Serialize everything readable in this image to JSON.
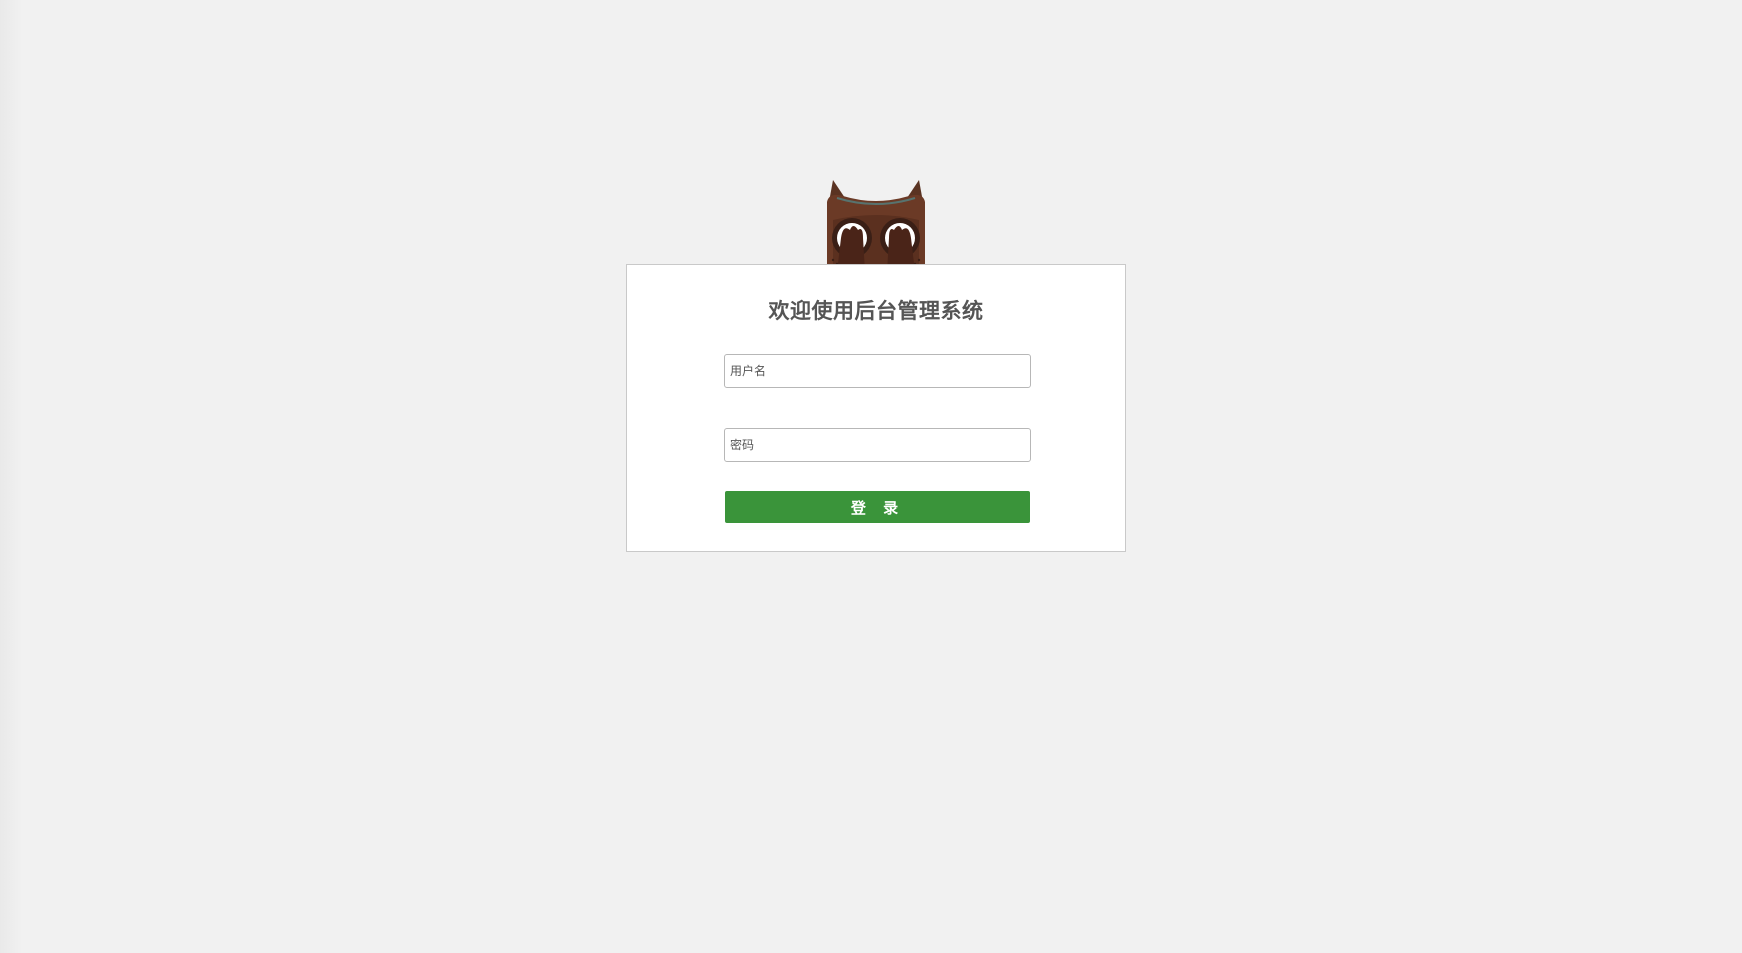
{
  "login": {
    "title": "欢迎使用后台管理系统",
    "username_placeholder": "用户名",
    "password_placeholder": "密码",
    "submit_label": "登 录"
  },
  "colors": {
    "background": "#f1f1f1",
    "card": "#ffffff",
    "accent_green": "#3a943a",
    "owl_brown": "#6b3a26"
  },
  "mascot": {
    "icon": "owl-mascot-icon"
  }
}
